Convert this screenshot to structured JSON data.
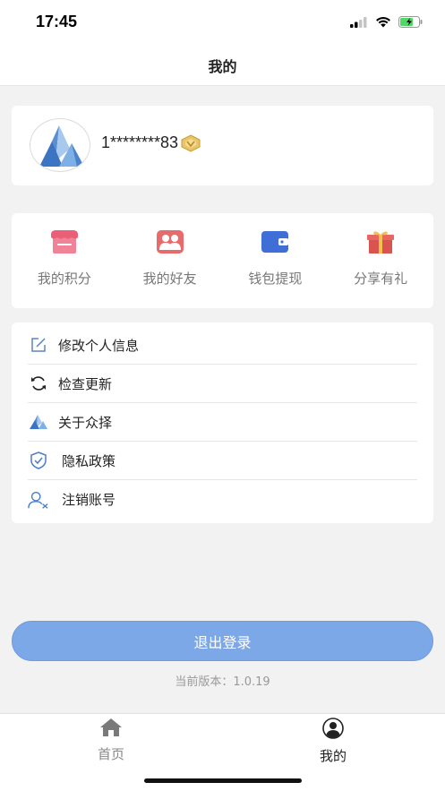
{
  "status_bar": {
    "time": "17:45"
  },
  "nav": {
    "title": "我的"
  },
  "profile": {
    "username": "1********83"
  },
  "quick_actions": [
    {
      "label": "我的积分",
      "icon": "shop-icon",
      "color": "#ee6b7f"
    },
    {
      "label": "我的好友",
      "icon": "friends-icon",
      "color": "#e86a6a"
    },
    {
      "label": "钱包提现",
      "icon": "wallet-icon",
      "color": "#3f6fd6"
    },
    {
      "label": "分享有礼",
      "icon": "gift-icon",
      "color": "#d9534f"
    }
  ],
  "menu": [
    {
      "label": "修改个人信息",
      "icon": "edit-icon"
    },
    {
      "label": "检查更新",
      "icon": "refresh-icon"
    },
    {
      "label": "关于众择",
      "icon": "logo-icon"
    },
    {
      "label": "隐私政策",
      "icon": "shield-icon"
    },
    {
      "label": "注销账号",
      "icon": "remove-user-icon"
    }
  ],
  "logout": {
    "label": "退出登录",
    "color": "#7ca8e8"
  },
  "version": {
    "text": "当前版本：1.0.19"
  },
  "tab_bar": {
    "tabs": [
      {
        "label": "首页",
        "icon": "home-icon",
        "active": false
      },
      {
        "label": "我的",
        "icon": "user-icon",
        "active": true
      }
    ]
  }
}
